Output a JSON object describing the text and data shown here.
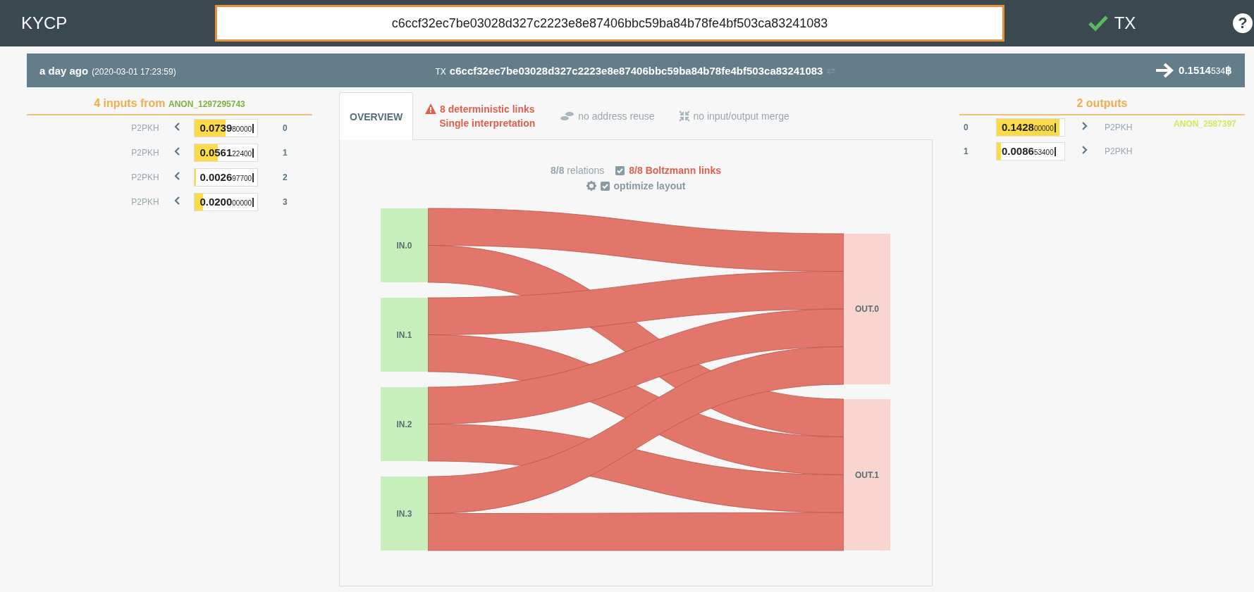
{
  "header": {
    "logo": "KYCP",
    "search": {
      "value": "c6ccf32ec7be03028d327c2223e8e87406bbc59ba84b78fe4bf503ca83241083"
    },
    "status": {
      "label": "TX",
      "verified": true
    },
    "help": "?"
  },
  "tx_bar": {
    "age": "a day ago",
    "timestamp": "(2020-03-01 17:23:59)",
    "prefix": "TX",
    "hash": "c6ccf32ec7be03028d327c2223e8e87406bbc59ba84b78fe4bf503ca83241083",
    "amount": "0.1514",
    "amount_small": "534",
    "currency": "฿"
  },
  "inputs": {
    "count_label": "4 inputs from",
    "cluster": "ANON_1297295743",
    "rows": [
      {
        "type": "P2PKH",
        "amount": "0.0739",
        "amount_small": "80000",
        "index": "0",
        "level": 0.49
      },
      {
        "type": "P2PKH",
        "amount": "0.0561",
        "amount_small": "22400",
        "index": "1",
        "level": 0.37
      },
      {
        "type": "P2PKH",
        "amount": "0.0026",
        "amount_small": "97700",
        "index": "2",
        "level": 0.02
      },
      {
        "type": "P2PKH",
        "amount": "0.0200",
        "amount_small": "00000",
        "index": "3",
        "level": 0.13
      }
    ]
  },
  "outputs": {
    "count_label": "2 outputs",
    "cluster": "ANON_2587397",
    "rows": [
      {
        "index": "0",
        "amount": "0.1428",
        "amount_small": "00000",
        "type": "P2PKH",
        "level": 0.93
      },
      {
        "index": "1",
        "amount": "0.0086",
        "amount_small": "53400",
        "type": "P2PKH",
        "level": 0.06
      }
    ]
  },
  "tabs": [
    {
      "kind": "plain",
      "label": "OVERVIEW",
      "selected": true
    },
    {
      "kind": "warning",
      "lines": [
        "8 deterministic links",
        "Single interpretation"
      ],
      "selected": false
    },
    {
      "kind": "reuse",
      "label": "no address reuse",
      "selected": false
    },
    {
      "kind": "merge",
      "label": "no input/output merge",
      "selected": false
    }
  ],
  "graph": {
    "relations": "**8/8** relations",
    "options": [
      {
        "kind": "boltzmann",
        "label": "8/8 Boltzmann links",
        "checked": true
      },
      {
        "kind": "layout",
        "label": "optimize layout",
        "checked": true
      }
    ],
    "inputs": [
      "IN.0",
      "IN.1",
      "IN.2",
      "IN.3"
    ],
    "outputs": [
      "OUT.0",
      "OUT.1"
    ]
  }
}
